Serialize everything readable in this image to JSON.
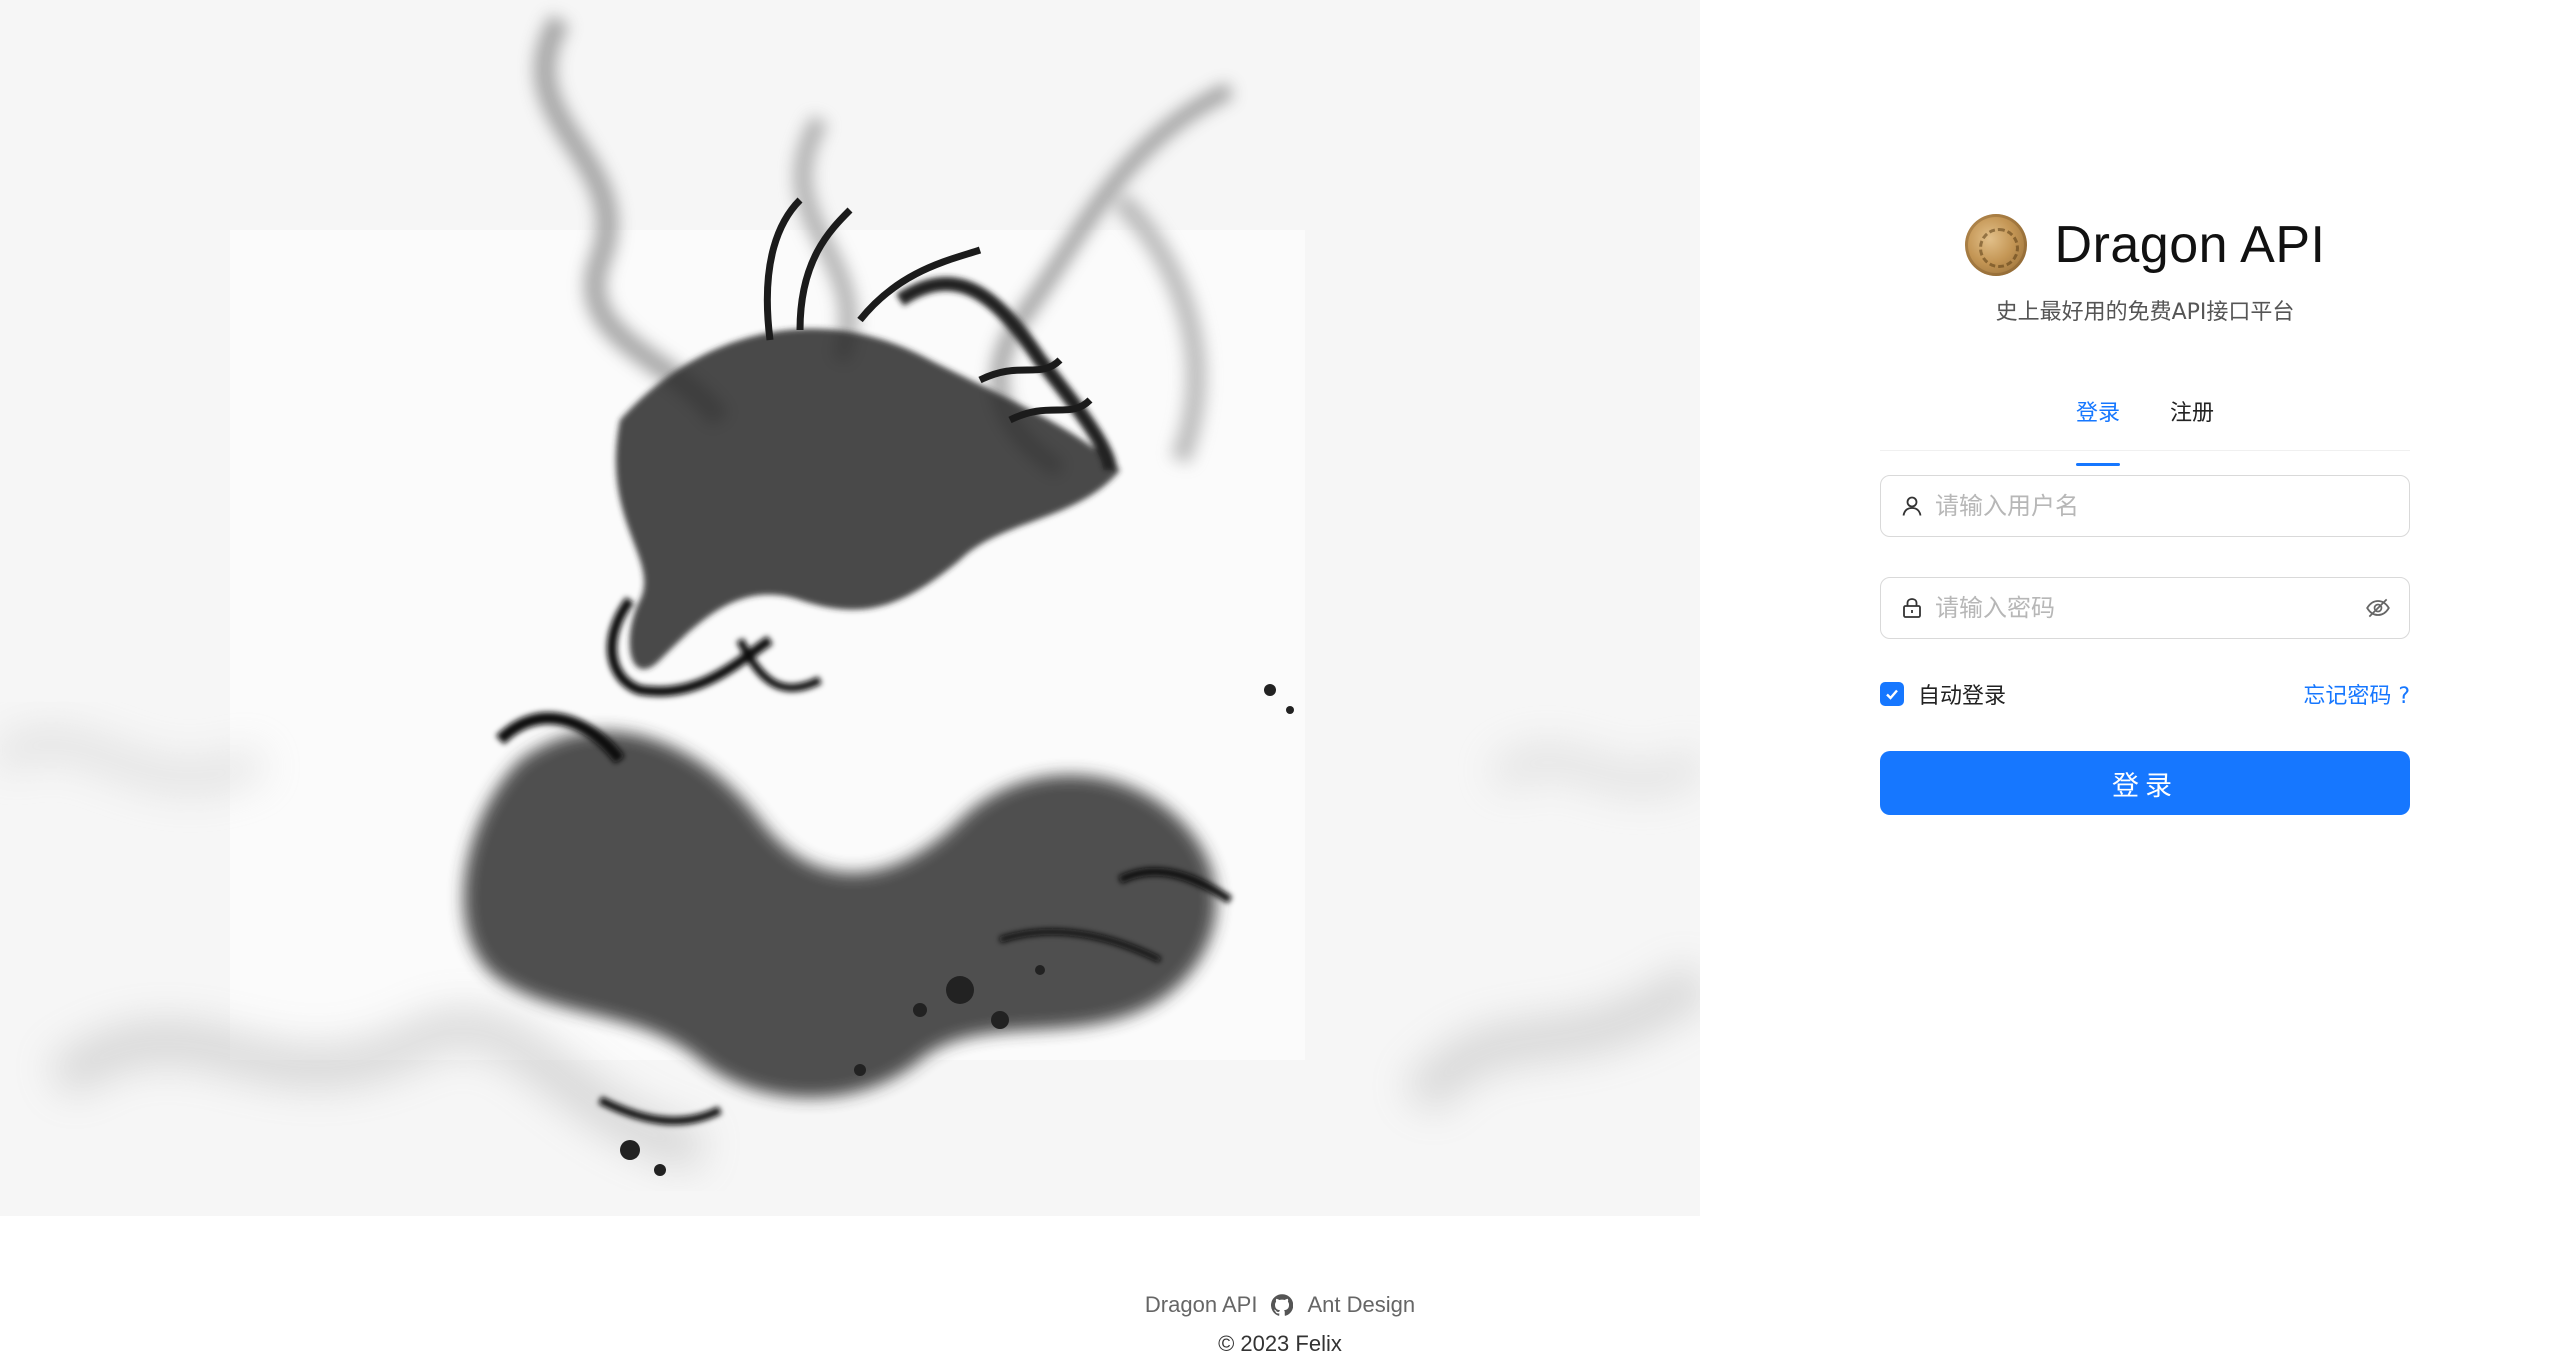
{
  "brand": {
    "title": "Dragon API",
    "subtitle": "史上最好用的免费API接口平台",
    "logo_icon": "dragon-seal-icon"
  },
  "tabs": [
    {
      "label": "登录",
      "active": true
    },
    {
      "label": "注册",
      "active": false
    }
  ],
  "form": {
    "username": {
      "placeholder": "请输入用户名",
      "value": "",
      "icon": "user-icon"
    },
    "password": {
      "placeholder": "请输入密码",
      "value": "",
      "icon": "lock-icon",
      "toggle_icon": "eye-invisible-icon"
    },
    "remember": {
      "label": "自动登录",
      "checked": true
    },
    "forgot_label": "忘记密码 ?",
    "submit_label": "登录"
  },
  "footer": {
    "links": [
      "Dragon API",
      "Ant Design"
    ],
    "link_icon": "github-icon",
    "copyright": "2023 Felix"
  },
  "colors": {
    "primary": "#1677ff",
    "hero_bg": "#f6f6f6"
  }
}
